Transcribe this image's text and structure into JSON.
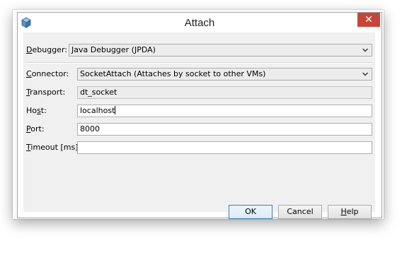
{
  "window": {
    "title": "Attach",
    "close_glyph": "✕"
  },
  "icons": {
    "app": "netbeans-cube-icon",
    "close": "close-icon",
    "dropdown": "chevron-down-icon"
  },
  "form": {
    "debugger": {
      "label_mnemonic": "D",
      "label_rest": "ebugger:",
      "value": "Java Debugger (JPDA)"
    },
    "connector": {
      "label_mnemonic": "C",
      "label_rest": "onnector:",
      "value": "SocketAttach (Attaches by socket to other VMs)"
    },
    "transport": {
      "label_mnemonic": "T",
      "label_rest": "ransport:",
      "value": "dt_socket"
    },
    "host": {
      "label_pre": "Ho",
      "label_mnemonic": "s",
      "label_rest": "t:",
      "value": "localhost"
    },
    "port": {
      "label_mnemonic": "P",
      "label_rest": "ort:",
      "value": "8000"
    },
    "timeout": {
      "label_mnemonic": "T",
      "label_rest": "imeout [ms]:",
      "value": ""
    }
  },
  "buttons": {
    "ok": "OK",
    "cancel": "Cancel",
    "help_mnemonic": "H",
    "help_rest": "elp"
  },
  "colors": {
    "close_button": "#c7463a",
    "default_button_border": "#3c7fb1",
    "dialog_background": "#f0f0f0"
  }
}
